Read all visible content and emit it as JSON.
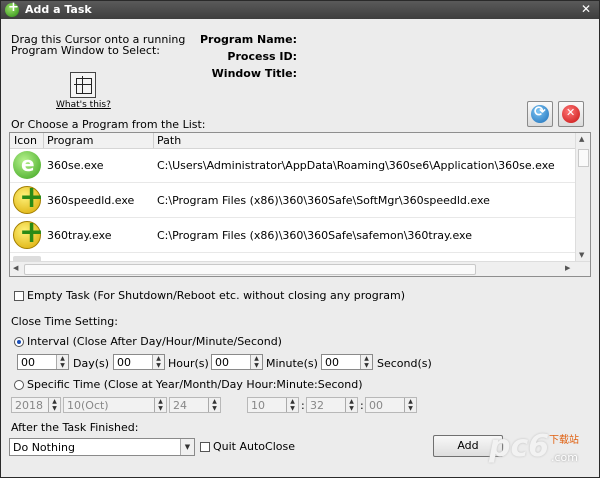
{
  "window": {
    "title": "Add a Task",
    "close_glyph": "✕"
  },
  "drag": {
    "line1": "Drag this Cursor onto a running",
    "line2": "Program Window to Select:",
    "whats_this": "What's this?"
  },
  "info": {
    "program_name": "Program Name:",
    "process_id": "Process ID:",
    "window_title": "Window Title:"
  },
  "list": {
    "caption": "Or Choose a Program from the List:",
    "columns": [
      "Icon",
      "Program",
      "Path"
    ],
    "rows": [
      {
        "program": "360se.exe",
        "path": "C:\\Users\\Administrator\\AppData\\Roaming\\360se6\\Application\\360se.exe",
        "icon": "360se-icon"
      },
      {
        "program": "360speedld.exe",
        "path": "C:\\Program Files (x86)\\360\\360Safe\\SoftMgr\\360speedld.exe",
        "icon": "360speedld-icon"
      },
      {
        "program": "360tray.exe",
        "path": "C:\\Program Files (x86)\\360\\360Safe\\safemon\\360tray.exe",
        "icon": "360tray-icon"
      }
    ]
  },
  "empty_task": "Empty Task (For Shutdown/Reboot etc. without closing any program)",
  "close_time": {
    "label": "Close Time Setting:",
    "interval": {
      "label": "Interval (Close After Day/Hour/Minute/Second)",
      "day": "00",
      "day_unit": "Day(s)",
      "hour": "00",
      "hour_unit": "Hour(s)",
      "minute": "00",
      "minute_unit": "Minute(s)",
      "second": "00",
      "second_unit": "Second(s)"
    },
    "specific": {
      "label": "Specific Time (Close at Year/Month/Day Hour:Minute:Second)",
      "year": "2018",
      "month": "10(Oct)",
      "day": "24",
      "hour": "10",
      "minute": "32",
      "second": "00",
      "sep": ":"
    }
  },
  "after": {
    "label": "After the Task Finished:",
    "selected": "Do Nothing",
    "quit_autoclose": "Quit AutoClose"
  },
  "add_button": "Add",
  "watermark": {
    "big": "pc6",
    "small1": "下载站",
    "small2": ".com"
  }
}
